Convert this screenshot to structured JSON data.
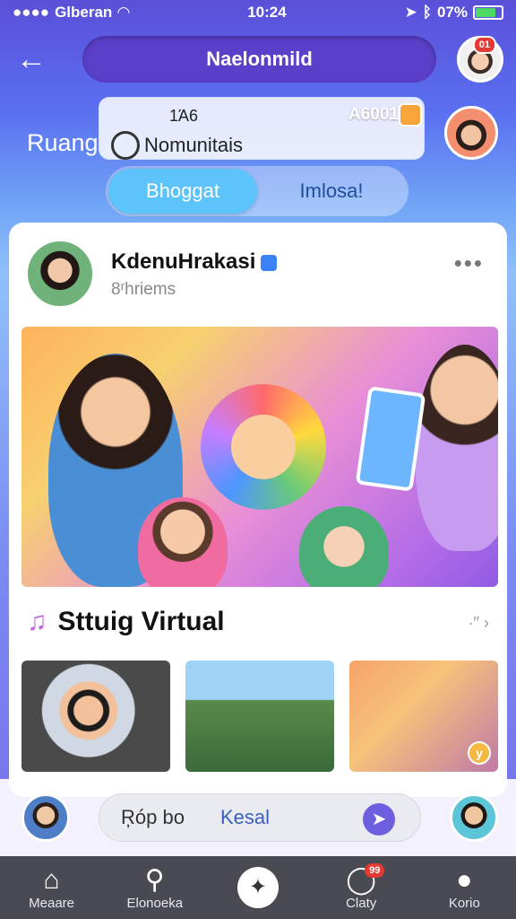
{
  "status_bar": {
    "carrier": "Glberan",
    "time": "10:24",
    "battery": "07%"
  },
  "header": {
    "title": "Naelonmild",
    "avatar_badge": "01"
  },
  "community": {
    "label": "Ruang",
    "name": "Nomunitais",
    "count": "1Ά6",
    "points": "A6001"
  },
  "tabs": [
    {
      "label": "Bhoggat",
      "active": true
    },
    {
      "label": "Imlosa!",
      "active": false
    }
  ],
  "post": {
    "author": "KdenuHrakasi",
    "subtitle": "8ʳhriems",
    "more": "•••"
  },
  "section": {
    "title": "Sttuig Virtual",
    "more": "∙′′ ›"
  },
  "thumb_badge": "y",
  "composer": {
    "placeholder_left": "Ŗóp bo",
    "placeholder_right": "Kesal"
  },
  "nav": [
    {
      "label": "Meaare",
      "icon": "home-icon"
    },
    {
      "label": "Elonoeka",
      "icon": "search-icon"
    },
    {
      "label": "",
      "icon": "compass-icon"
    },
    {
      "label": "Claty",
      "icon": "chat-icon",
      "badge": "99"
    },
    {
      "label": "Korio",
      "icon": "profile-icon"
    }
  ]
}
